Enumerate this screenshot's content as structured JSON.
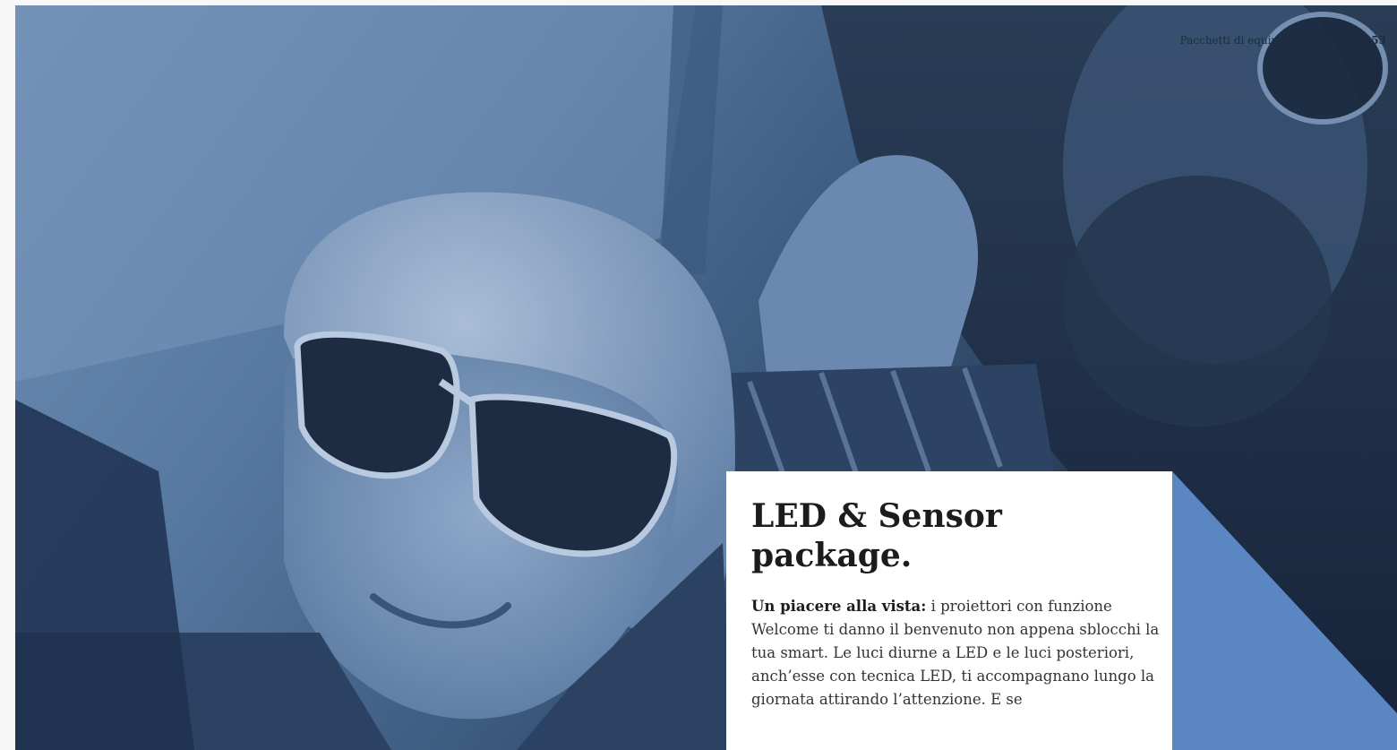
{
  "header": {
    "section": "Pacchetti di equipaggiamenti",
    "page_left": "52",
    "page_right": "53"
  },
  "feature": {
    "title_line1": "LED & Sensor",
    "title_line2": "package.",
    "lead": "Un piacere alla vista:",
    "body": " i proiettori con funzione Welcome ti danno il benvenuto non appena sblocchi la tua smart. Le luci diurne a LED e le luci posteriori, anch’esse con tecnica LED, ti accompagnano lungo la giornata attirando l’attenzione. E se"
  },
  "colors": {
    "photo_tint": "#4a6c96",
    "accent_triangle": "#5a86c1",
    "card": "#ffffff"
  }
}
